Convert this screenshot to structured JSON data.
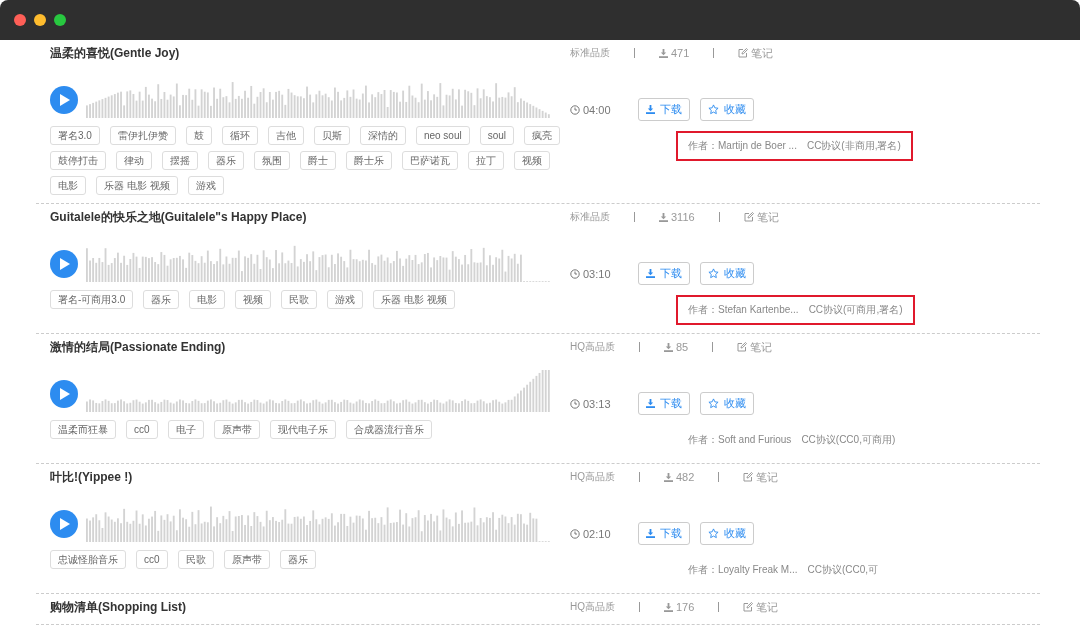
{
  "window": {
    "controls": [
      {
        "kind": "close"
      },
      {
        "kind": "minimize"
      },
      {
        "kind": "zoom"
      }
    ]
  },
  "tracks": [
    {
      "title": "温柔的喜悦(Gentle Joy)",
      "quality": "标准品质",
      "downloads": "471",
      "note": "笔记",
      "duration": "04:00",
      "download_label": "下载",
      "favorite_label": "收藏",
      "author": "作者：Martijn de Boer ...",
      "license": "CC协议(非商用,署名)",
      "highlighted": true,
      "tags": [
        "署名3.0",
        "雷伊扎伊赞",
        "鼓",
        "循环",
        "吉他",
        "贝斯",
        "深情的",
        "neo soul",
        "soul",
        "疯亮",
        "鼓停打击",
        "律动",
        "摆摇",
        "器乐",
        "氛围",
        "爵士",
        "爵士乐",
        "巴萨诺瓦",
        "拉丁",
        "视频",
        "电影",
        "乐器 电影 视频",
        "游戏"
      ]
    },
    {
      "title": "Guitalele的快乐之地(Guitalele\"s Happy Place)",
      "quality": "标准品质",
      "downloads": "3116",
      "note": "笔记",
      "duration": "03:10",
      "download_label": "下载",
      "favorite_label": "收藏",
      "author": "作者：Stefan Kartenbe...",
      "license": "CC协议(可商用,署名)",
      "highlighted": true,
      "tags": [
        "署名-可商用3.0",
        "器乐",
        "电影",
        "视频",
        "民歌",
        "游戏",
        "乐器 电影 视频"
      ]
    },
    {
      "title": "激情的结局(Passionate Ending)",
      "quality": "HQ高品质",
      "downloads": "85",
      "note": "笔记",
      "duration": "03:13",
      "download_label": "下载",
      "favorite_label": "收藏",
      "author": "作者：Soft and Furious",
      "license": "CC协议(CC0,可商用)",
      "highlighted": false,
      "tags": [
        "温柔而狂暴",
        "cc0",
        "电子",
        "原声带",
        "现代电子乐",
        "合成器流行音乐"
      ]
    },
    {
      "title": "叶比!(Yippee !)",
      "quality": "HQ高品质",
      "downloads": "482",
      "note": "笔记",
      "duration": "02:10",
      "download_label": "下载",
      "favorite_label": "收藏",
      "author": "作者：Loyalty Freak M...",
      "license": "CC协议(CC0,可",
      "highlighted": false,
      "tags": [
        "忠诚怪胎音乐",
        "cc0",
        "民歌",
        "原声带",
        "器乐"
      ]
    },
    {
      "title": "购物清单(Shopping List)",
      "quality": "HQ高品质",
      "downloads": "176",
      "note": "笔记"
    }
  ]
}
